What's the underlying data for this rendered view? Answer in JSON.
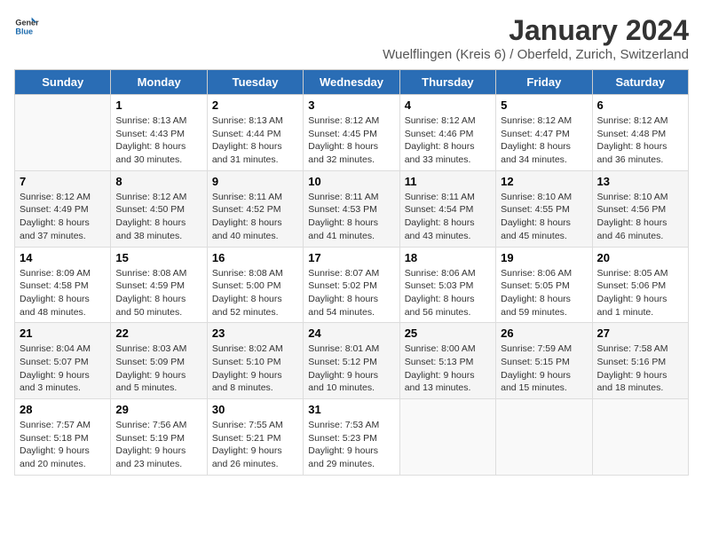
{
  "logo": {
    "text_general": "General",
    "text_blue": "Blue"
  },
  "title": "January 2024",
  "subtitle": "Wuelflingen (Kreis 6) / Oberfeld, Zurich, Switzerland",
  "days_of_week": [
    "Sunday",
    "Monday",
    "Tuesday",
    "Wednesday",
    "Thursday",
    "Friday",
    "Saturday"
  ],
  "weeks": [
    [
      {
        "day": "",
        "sunrise": "",
        "sunset": "",
        "daylight": ""
      },
      {
        "day": "1",
        "sunrise": "8:13 AM",
        "sunset": "4:43 PM",
        "daylight": "8 hours and 30 minutes."
      },
      {
        "day": "2",
        "sunrise": "8:13 AM",
        "sunset": "4:44 PM",
        "daylight": "8 hours and 31 minutes."
      },
      {
        "day": "3",
        "sunrise": "8:12 AM",
        "sunset": "4:45 PM",
        "daylight": "8 hours and 32 minutes."
      },
      {
        "day": "4",
        "sunrise": "8:12 AM",
        "sunset": "4:46 PM",
        "daylight": "8 hours and 33 minutes."
      },
      {
        "day": "5",
        "sunrise": "8:12 AM",
        "sunset": "4:47 PM",
        "daylight": "8 hours and 34 minutes."
      },
      {
        "day": "6",
        "sunrise": "8:12 AM",
        "sunset": "4:48 PM",
        "daylight": "8 hours and 36 minutes."
      }
    ],
    [
      {
        "day": "7",
        "sunrise": "8:12 AM",
        "sunset": "4:49 PM",
        "daylight": "8 hours and 37 minutes."
      },
      {
        "day": "8",
        "sunrise": "8:12 AM",
        "sunset": "4:50 PM",
        "daylight": "8 hours and 38 minutes."
      },
      {
        "day": "9",
        "sunrise": "8:11 AM",
        "sunset": "4:52 PM",
        "daylight": "8 hours and 40 minutes."
      },
      {
        "day": "10",
        "sunrise": "8:11 AM",
        "sunset": "4:53 PM",
        "daylight": "8 hours and 41 minutes."
      },
      {
        "day": "11",
        "sunrise": "8:11 AM",
        "sunset": "4:54 PM",
        "daylight": "8 hours and 43 minutes."
      },
      {
        "day": "12",
        "sunrise": "8:10 AM",
        "sunset": "4:55 PM",
        "daylight": "8 hours and 45 minutes."
      },
      {
        "day": "13",
        "sunrise": "8:10 AM",
        "sunset": "4:56 PM",
        "daylight": "8 hours and 46 minutes."
      }
    ],
    [
      {
        "day": "14",
        "sunrise": "8:09 AM",
        "sunset": "4:58 PM",
        "daylight": "8 hours and 48 minutes."
      },
      {
        "day": "15",
        "sunrise": "8:08 AM",
        "sunset": "4:59 PM",
        "daylight": "8 hours and 50 minutes."
      },
      {
        "day": "16",
        "sunrise": "8:08 AM",
        "sunset": "5:00 PM",
        "daylight": "8 hours and 52 minutes."
      },
      {
        "day": "17",
        "sunrise": "8:07 AM",
        "sunset": "5:02 PM",
        "daylight": "8 hours and 54 minutes."
      },
      {
        "day": "18",
        "sunrise": "8:06 AM",
        "sunset": "5:03 PM",
        "daylight": "8 hours and 56 minutes."
      },
      {
        "day": "19",
        "sunrise": "8:06 AM",
        "sunset": "5:05 PM",
        "daylight": "8 hours and 59 minutes."
      },
      {
        "day": "20",
        "sunrise": "8:05 AM",
        "sunset": "5:06 PM",
        "daylight": "9 hours and 1 minute."
      }
    ],
    [
      {
        "day": "21",
        "sunrise": "8:04 AM",
        "sunset": "5:07 PM",
        "daylight": "9 hours and 3 minutes."
      },
      {
        "day": "22",
        "sunrise": "8:03 AM",
        "sunset": "5:09 PM",
        "daylight": "9 hours and 5 minutes."
      },
      {
        "day": "23",
        "sunrise": "8:02 AM",
        "sunset": "5:10 PM",
        "daylight": "9 hours and 8 minutes."
      },
      {
        "day": "24",
        "sunrise": "8:01 AM",
        "sunset": "5:12 PM",
        "daylight": "9 hours and 10 minutes."
      },
      {
        "day": "25",
        "sunrise": "8:00 AM",
        "sunset": "5:13 PM",
        "daylight": "9 hours and 13 minutes."
      },
      {
        "day": "26",
        "sunrise": "7:59 AM",
        "sunset": "5:15 PM",
        "daylight": "9 hours and 15 minutes."
      },
      {
        "day": "27",
        "sunrise": "7:58 AM",
        "sunset": "5:16 PM",
        "daylight": "9 hours and 18 minutes."
      }
    ],
    [
      {
        "day": "28",
        "sunrise": "7:57 AM",
        "sunset": "5:18 PM",
        "daylight": "9 hours and 20 minutes."
      },
      {
        "day": "29",
        "sunrise": "7:56 AM",
        "sunset": "5:19 PM",
        "daylight": "9 hours and 23 minutes."
      },
      {
        "day": "30",
        "sunrise": "7:55 AM",
        "sunset": "5:21 PM",
        "daylight": "9 hours and 26 minutes."
      },
      {
        "day": "31",
        "sunrise": "7:53 AM",
        "sunset": "5:23 PM",
        "daylight": "9 hours and 29 minutes."
      },
      {
        "day": "",
        "sunrise": "",
        "sunset": "",
        "daylight": ""
      },
      {
        "day": "",
        "sunrise": "",
        "sunset": "",
        "daylight": ""
      },
      {
        "day": "",
        "sunrise": "",
        "sunset": "",
        "daylight": ""
      }
    ]
  ]
}
